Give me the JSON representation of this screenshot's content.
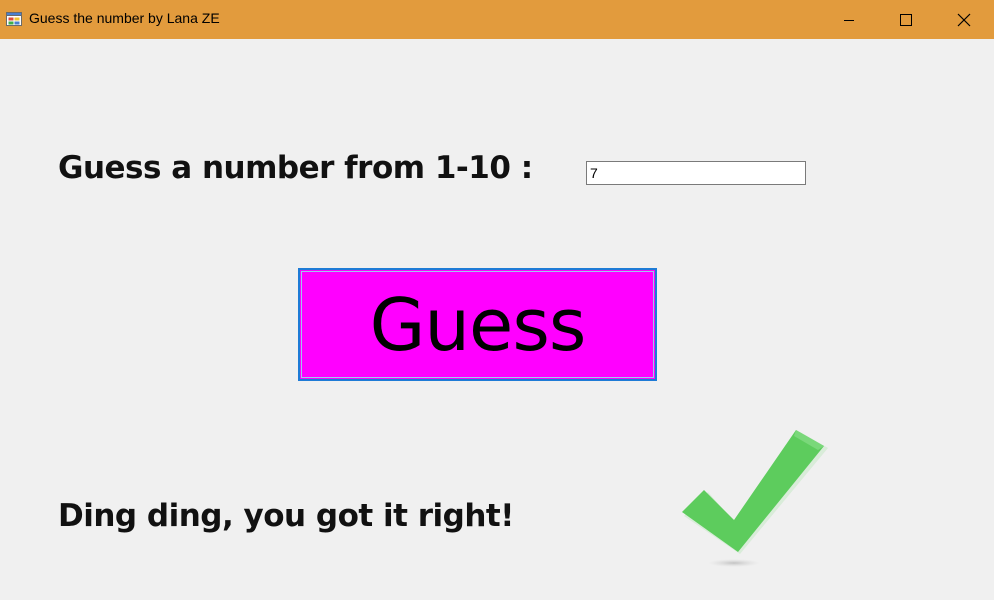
{
  "window": {
    "title": "Guess the number by Lana ZE",
    "app_icon": "form-app-icon",
    "titlebar_color": "#e29b3d",
    "controls": {
      "minimize_icon": "minimize-icon",
      "maximize_icon": "maximize-icon",
      "close_icon": "close-icon"
    }
  },
  "form": {
    "prompt_label": "Guess a number from 1-10 :",
    "guess_input_value": "7",
    "guess_button_label": "Guess",
    "guess_button_color": "#ff00ff",
    "result_text": "Ding ding, you got it right!",
    "result_icon": "checkmark-icon",
    "checkmark_color": "#5dcc5d"
  }
}
